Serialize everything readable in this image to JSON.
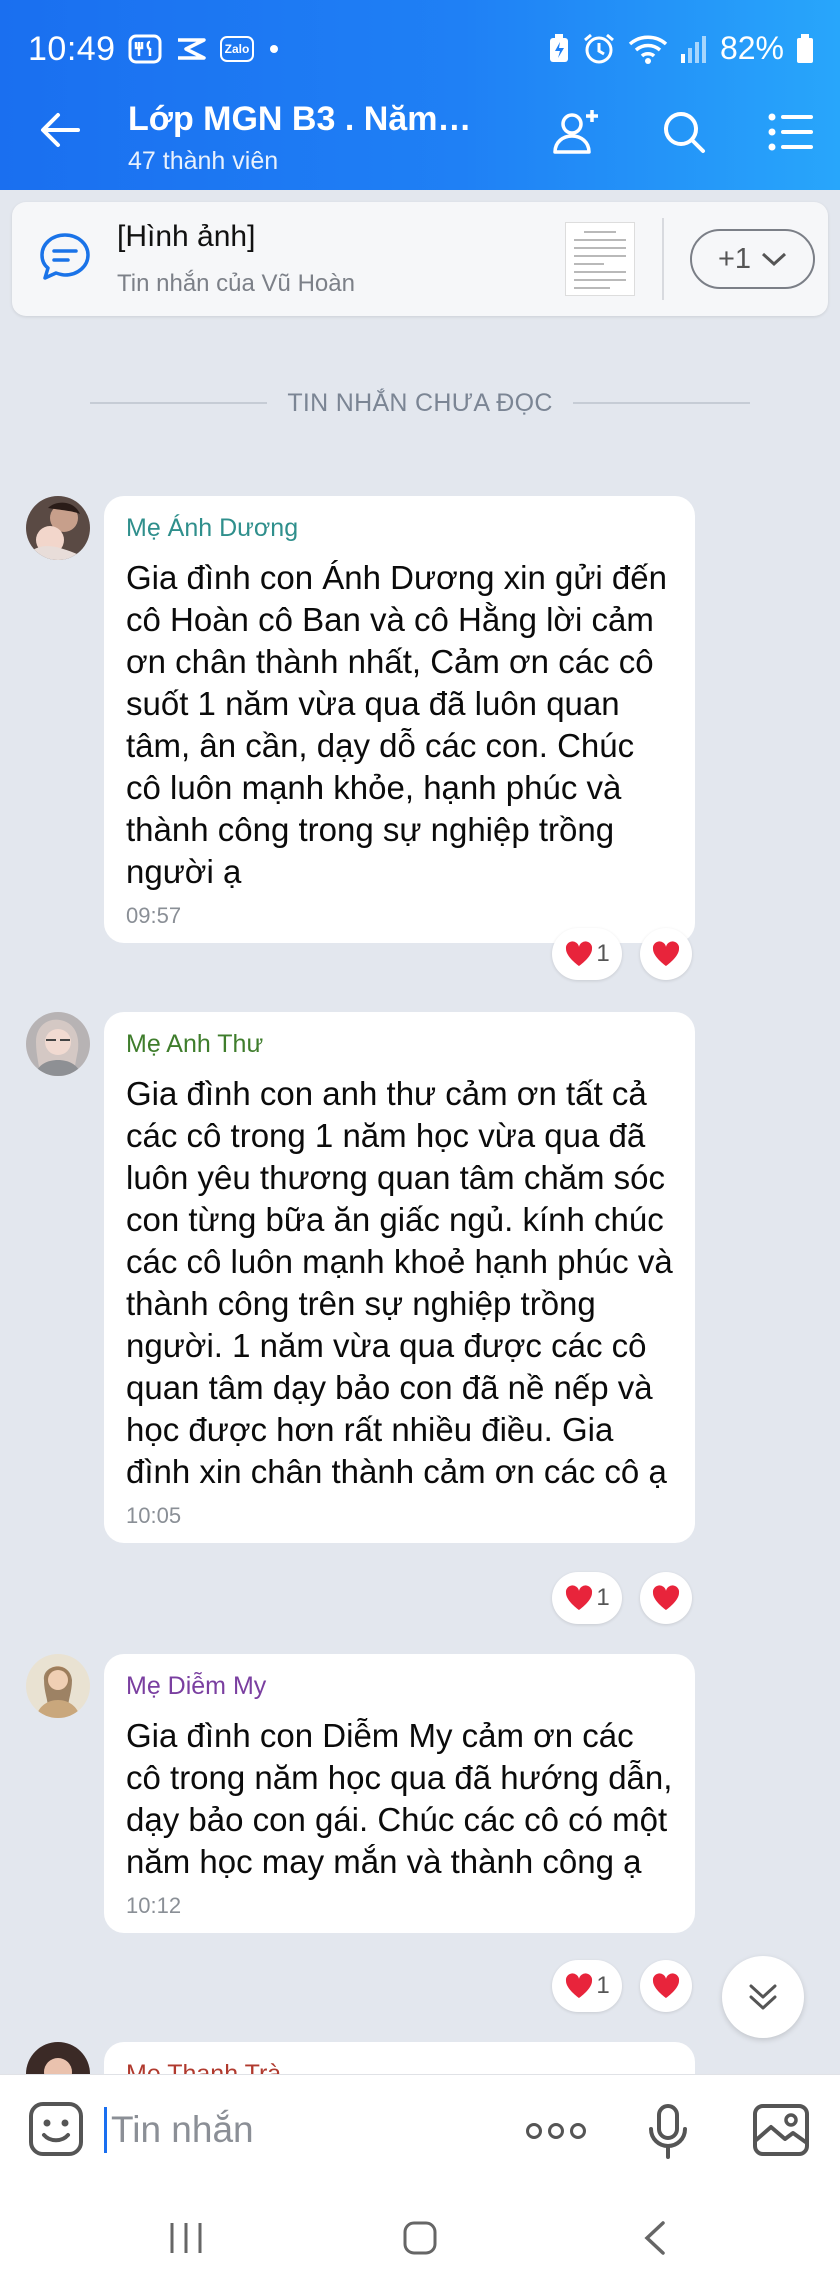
{
  "status_bar": {
    "time": "10:49",
    "notification_icons": [
      "restaurant-app-icon",
      "capcut-icon",
      "zalo-icon"
    ],
    "zalo_badge": "Zalo",
    "battery": "82%"
  },
  "header": {
    "title": "Lớp MGN B3 . Năm…",
    "subtitle": "47 thành viên"
  },
  "pinned": {
    "title": "[Hình ảnh]",
    "subtitle": "Tin nhắn của Vũ Hoàn",
    "more_label": "+1"
  },
  "unread_label": "TIN NHẮN CHƯA ĐỌC",
  "messages": [
    {
      "sender": "Mẹ Ánh Dương",
      "sender_color": "#2f8f8c",
      "text": "Gia đình con Ánh Dương xin gửi đến cô Hoàn cô Ban và cô Hằng lời cảm ơn chân thành nhất, Cảm ơn các cô suốt 1 năm vừa qua đã luôn quan tâm, ân cần, dạy dỗ các con. Chúc cô luôn mạnh khỏe, hạnh phúc và thành công trong sự nghiệp trồng người ạ",
      "time": "09:57",
      "reaction_count": "1"
    },
    {
      "sender": "Mẹ Anh Thư",
      "sender_color": "#3f7d2c",
      "text": "Gia đình con anh thư cảm ơn tất cả các cô trong 1 năm học vừa qua đã luôn yêu thương quan tâm chăm sóc con từng bữa ăn giấc ngủ. kính chúc các cô luôn mạnh khoẻ hạnh phúc và thành công trên sự nghiệp trồng người. 1 năm vừa qua được các cô quan tâm dạy bảo con đã nề nếp và học được hơn rất nhiều điều. Gia đình xin chân thành cảm ơn các cô ạ",
      "time": "10:05",
      "reaction_count": "1"
    },
    {
      "sender": "Mẹ Diễm My",
      "sender_color": "#7a3fa0",
      "text": "Gia đình con Diễm My cảm ơn các cô trong năm học qua đã hướng dẫn, dạy bảo con gái. Chúc các cô có một năm học may mắn và thành công ạ",
      "time": "10:12",
      "reaction_count": "1"
    },
    {
      "sender": "Mẹ Thanh Trà",
      "sender_color": "#b03a2e"
    }
  ],
  "input": {
    "placeholder": "Tin nhắn"
  }
}
